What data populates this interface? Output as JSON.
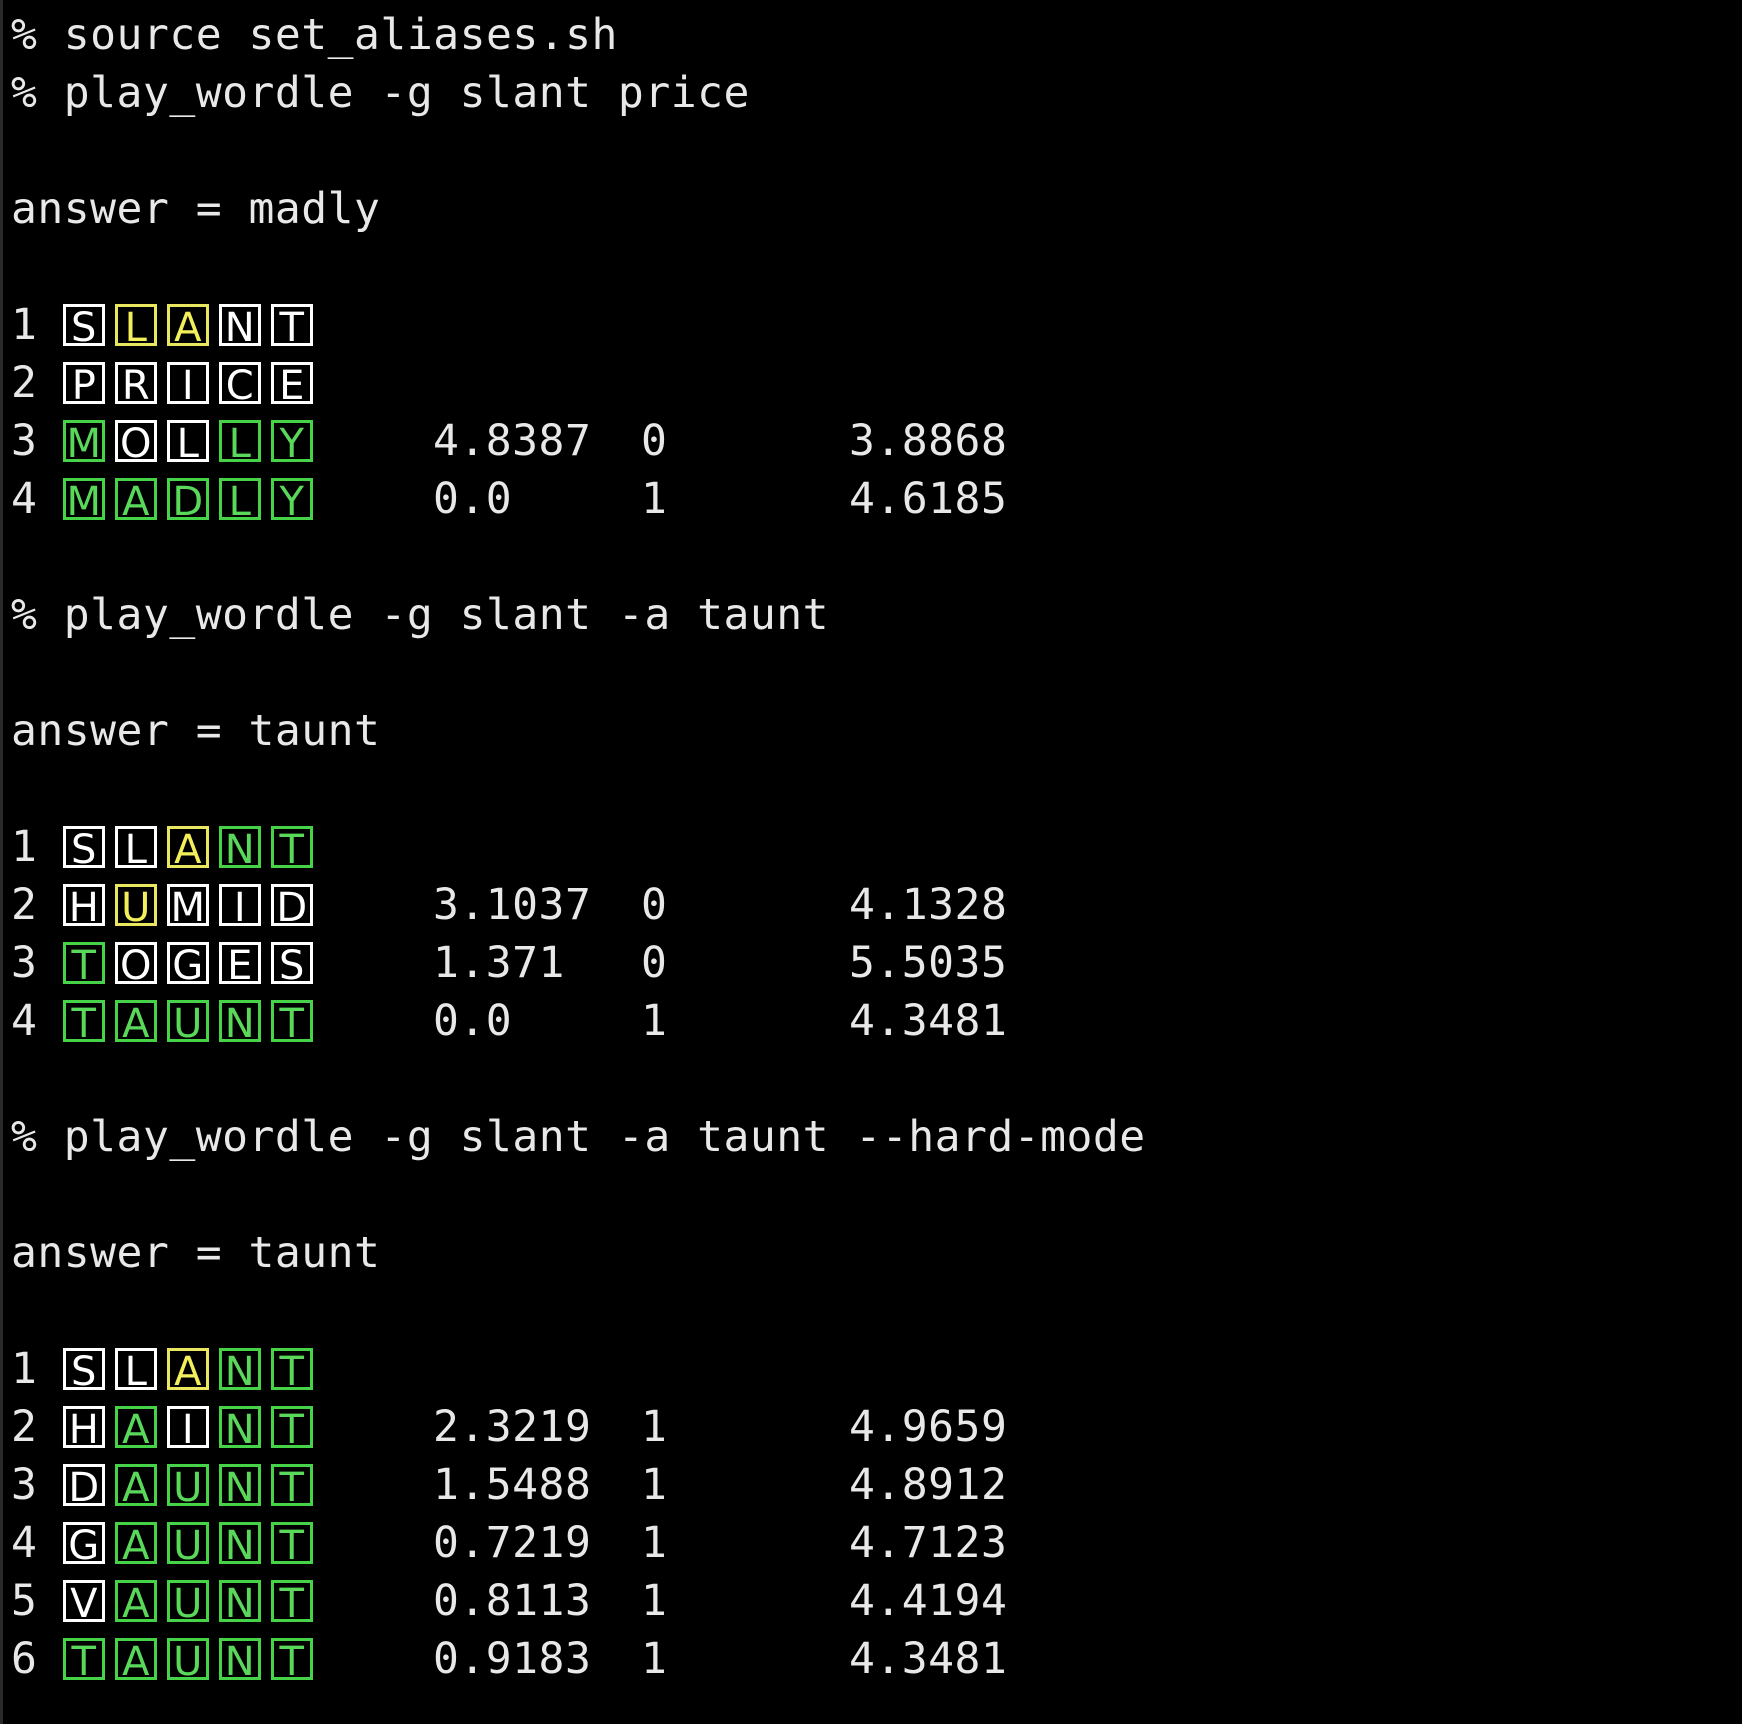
{
  "colors": {
    "background": "#000000",
    "text": "#e8e8e8",
    "absent": "#ffffff",
    "present": "#e9e65f",
    "correct": "#46d347"
  },
  "sessions": [
    {
      "preamble": "% source set_aliases.sh",
      "command": "% play_wordle -g slant price",
      "answer_line": "answer = madly",
      "rows": [
        {
          "n": "1",
          "letters": [
            "S",
            "L",
            "A",
            "N",
            "T"
          ],
          "states": [
            "absent",
            "present",
            "present",
            "absent",
            "absent"
          ],
          "v1": "",
          "v2": "",
          "v3": ""
        },
        {
          "n": "2",
          "letters": [
            "P",
            "R",
            "I",
            "C",
            "E"
          ],
          "states": [
            "absent",
            "absent",
            "absent",
            "absent",
            "absent"
          ],
          "v1": "",
          "v2": "",
          "v3": ""
        },
        {
          "n": "3",
          "letters": [
            "M",
            "O",
            "L",
            "L",
            "Y"
          ],
          "states": [
            "correct",
            "absent",
            "absent",
            "correct",
            "correct"
          ],
          "v1": "4.8387",
          "v2": "0",
          "v3": "3.8868"
        },
        {
          "n": "4",
          "letters": [
            "M",
            "A",
            "D",
            "L",
            "Y"
          ],
          "states": [
            "correct",
            "correct",
            "correct",
            "correct",
            "correct"
          ],
          "v1": "0.0",
          "v2": "1",
          "v3": "4.6185"
        }
      ]
    },
    {
      "preamble": "",
      "command": "% play_wordle -g slant -a taunt",
      "answer_line": "answer = taunt",
      "rows": [
        {
          "n": "1",
          "letters": [
            "S",
            "L",
            "A",
            "N",
            "T"
          ],
          "states": [
            "absent",
            "absent",
            "present",
            "correct",
            "correct"
          ],
          "v1": "",
          "v2": "",
          "v3": ""
        },
        {
          "n": "2",
          "letters": [
            "H",
            "U",
            "M",
            "I",
            "D"
          ],
          "states": [
            "absent",
            "present",
            "absent",
            "absent",
            "absent"
          ],
          "v1": "3.1037",
          "v2": "0",
          "v3": "4.1328"
        },
        {
          "n": "3",
          "letters": [
            "T",
            "O",
            "G",
            "E",
            "S"
          ],
          "states": [
            "correct",
            "absent",
            "absent",
            "absent",
            "absent"
          ],
          "v1": "1.371",
          "v2": "0",
          "v3": "5.5035"
        },
        {
          "n": "4",
          "letters": [
            "T",
            "A",
            "U",
            "N",
            "T"
          ],
          "states": [
            "correct",
            "correct",
            "correct",
            "correct",
            "correct"
          ],
          "v1": "0.0",
          "v2": "1",
          "v3": "4.3481"
        }
      ]
    },
    {
      "preamble": "",
      "command": "% play_wordle -g slant -a taunt --hard-mode",
      "answer_line": "answer = taunt",
      "rows": [
        {
          "n": "1",
          "letters": [
            "S",
            "L",
            "A",
            "N",
            "T"
          ],
          "states": [
            "absent",
            "absent",
            "present",
            "correct",
            "correct"
          ],
          "v1": "",
          "v2": "",
          "v3": ""
        },
        {
          "n": "2",
          "letters": [
            "H",
            "A",
            "I",
            "N",
            "T"
          ],
          "states": [
            "absent",
            "correct",
            "absent",
            "correct",
            "correct"
          ],
          "v1": "2.3219",
          "v2": "1",
          "v3": "4.9659"
        },
        {
          "n": "3",
          "letters": [
            "D",
            "A",
            "U",
            "N",
            "T"
          ],
          "states": [
            "absent",
            "correct",
            "correct",
            "correct",
            "correct"
          ],
          "v1": "1.5488",
          "v2": "1",
          "v3": "4.8912"
        },
        {
          "n": "4",
          "letters": [
            "G",
            "A",
            "U",
            "N",
            "T"
          ],
          "states": [
            "absent",
            "correct",
            "correct",
            "correct",
            "correct"
          ],
          "v1": "0.7219",
          "v2": "1",
          "v3": "4.7123"
        },
        {
          "n": "5",
          "letters": [
            "V",
            "A",
            "U",
            "N",
            "T"
          ],
          "states": [
            "absent",
            "correct",
            "correct",
            "correct",
            "correct"
          ],
          "v1": "0.8113",
          "v2": "1",
          "v3": "4.4194"
        },
        {
          "n": "6",
          "letters": [
            "T",
            "A",
            "U",
            "N",
            "T"
          ],
          "states": [
            "correct",
            "correct",
            "correct",
            "correct",
            "correct"
          ],
          "v1": "0.9183",
          "v2": "1",
          "v3": "4.3481"
        }
      ]
    }
  ]
}
